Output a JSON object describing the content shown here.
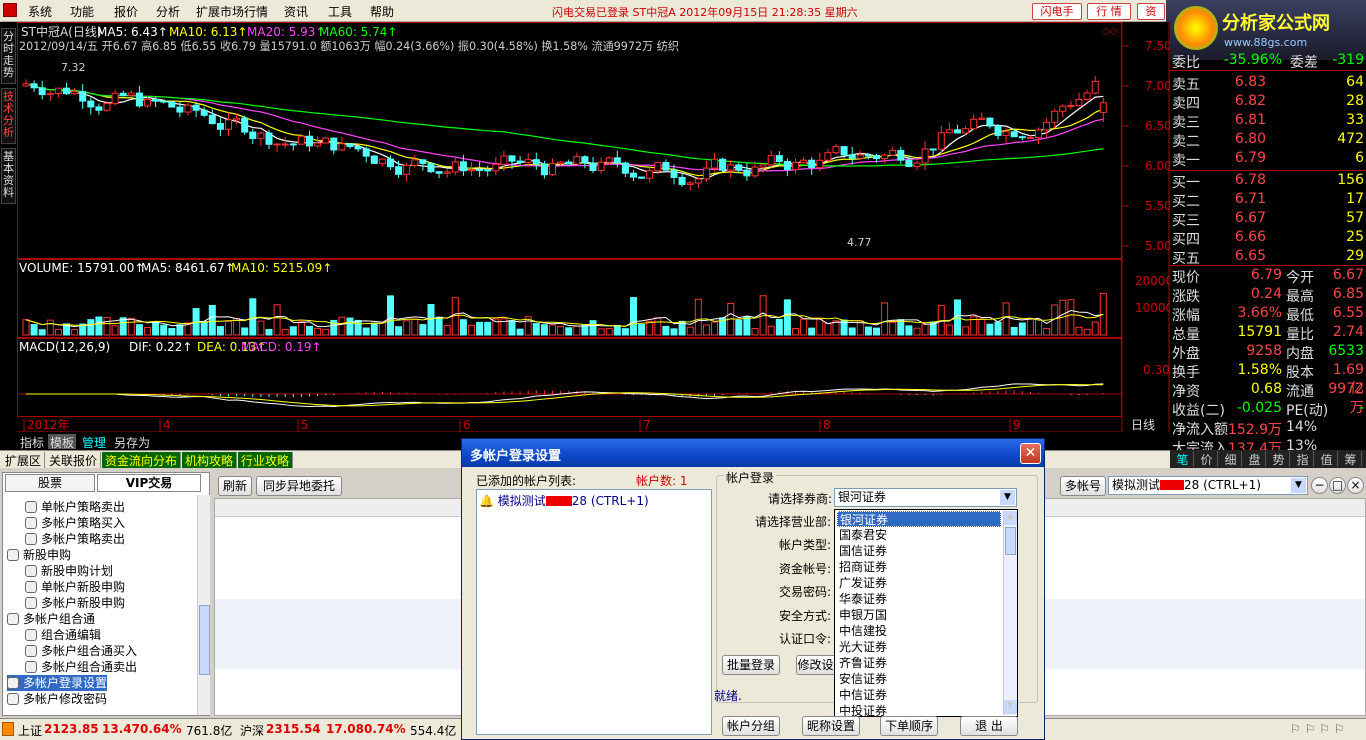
{
  "menu": [
    "系统",
    "功能",
    "报价",
    "分析",
    "扩展市场行情",
    "资讯",
    "工具",
    "帮助"
  ],
  "title_status": "闪电交易已登录   ST中冠A 2012年09月15日 21:28:35 星期六",
  "top_buttons": [
    "闪电手",
    "行 情",
    "资"
  ],
  "logo": {
    "title": "分析家公式网",
    "url": "www.88gs.com"
  },
  "left_tabs": [
    "分时走势",
    "技术分析",
    "基本资料"
  ],
  "chart": {
    "stock_name": "ST中冠A(日线)",
    "ma_info": [
      {
        "label": "MA5: 6.43↑",
        "color": "#ffffff"
      },
      {
        "label": "MA10: 6.13↑",
        "color": "#ffff00"
      },
      {
        "label": "MA20: 5.93↑",
        "color": "#ff44ff"
      },
      {
        "label": "MA60: 5.74↑",
        "color": "#00ff00"
      }
    ],
    "bar_info": "2012/09/14/五 开6.67 高6.85 低6.55 收6.79 量15791.0 额1063万 幅0.24(3.66%) 振0.30(4.58%) 换1.58% 流通9972万 纺织",
    "price_axis": [
      "7.50",
      "7.00",
      "6.50",
      "6.00",
      "5.50",
      "5.00"
    ],
    "hi_label": "7.32",
    "lo_label": "4.77",
    "vol_info": [
      {
        "label": "VOLUME: 15791.00↑",
        "color": "#ffffff"
      },
      {
        "label": "MA5: 8461.67↑",
        "color": "#ffffff"
      },
      {
        "label": "MA10: 5215.09↑",
        "color": "#ffff00"
      }
    ],
    "vol_axis": [
      "20000",
      "10000"
    ],
    "macd_info": [
      {
        "label": "MACD(12,26,9)",
        "color": "#ffffff"
      },
      {
        "label": "DIF: 0.22↑",
        "color": "#ffffff"
      },
      {
        "label": "DEA: 0.13↑",
        "color": "#ffff00"
      },
      {
        "label": "MACD: 0.19↑",
        "color": "#ff44ff"
      }
    ],
    "macd_axis": [
      "0.30"
    ],
    "date_axis": [
      "2012年",
      "4",
      "5",
      "6",
      "7",
      "8",
      "9"
    ],
    "period": "日线"
  },
  "quote": {
    "header": [
      {
        "label": "委比",
        "value": "-35.96%"
      },
      {
        "label": "委差",
        "value": "-319"
      }
    ],
    "sells": [
      {
        "label": "卖五",
        "price": "6.83",
        "vol": "64"
      },
      {
        "label": "卖四",
        "price": "6.82",
        "vol": "28"
      },
      {
        "label": "卖三",
        "price": "6.81",
        "vol": "33"
      },
      {
        "label": "卖二",
        "price": "6.80",
        "vol": "472"
      },
      {
        "label": "卖一",
        "price": "6.79",
        "vol": "6"
      }
    ],
    "buys": [
      {
        "label": "买一",
        "price": "6.78",
        "vol": "156"
      },
      {
        "label": "买二",
        "price": "6.71",
        "vol": "17"
      },
      {
        "label": "买三",
        "price": "6.67",
        "vol": "57"
      },
      {
        "label": "买四",
        "price": "6.66",
        "vol": "25"
      },
      {
        "label": "买五",
        "price": "6.65",
        "vol": "29"
      }
    ],
    "stats": [
      [
        "现价",
        "6.79",
        "今开",
        "6.67"
      ],
      [
        "涨跌",
        "0.24",
        "最高",
        "6.85"
      ],
      [
        "涨幅",
        "3.66%",
        "最低",
        "6.55"
      ],
      [
        "总量",
        "15791",
        "量比",
        "2.74"
      ],
      [
        "外盘",
        "9258",
        "内盘",
        "6533"
      ],
      [
        "换手",
        "1.58%",
        "股本",
        "1.69亿"
      ],
      [
        "净资",
        "0.68",
        "流通",
        "9972万"
      ],
      [
        "收益(二)",
        "-0.025",
        "PE(动)",
        "-"
      ],
      [
        "净流入额",
        "152.9万",
        "14%",
        ""
      ],
      [
        "大宗流入",
        "137.4万",
        "13%",
        ""
      ]
    ]
  },
  "bottom_tabs": [
    "指标",
    "模板",
    "管理",
    "另存为"
  ],
  "quick_tabs": [
    "扩展区",
    "关联报价",
    "资金流向分布",
    "机构攻略",
    "行业攻略"
  ],
  "side_tabs": [
    "笔",
    "价",
    "细",
    "盘",
    "势",
    "指",
    "值",
    "筹"
  ],
  "trade": {
    "tabs": [
      "股票",
      "VIP交易"
    ],
    "tree": [
      {
        "label": "单帐户策略卖出",
        "indent": 1,
        "sel": false
      },
      {
        "label": "多帐户策略买入",
        "indent": 1,
        "sel": false
      },
      {
        "label": "多帐户策略卖出",
        "indent": 1,
        "sel": false
      },
      {
        "label": "新股申购",
        "indent": 0,
        "sel": false
      },
      {
        "label": "新股申购计划",
        "indent": 1,
        "sel": false
      },
      {
        "label": "单帐户新股申购",
        "indent": 1,
        "sel": false
      },
      {
        "label": "多帐户新股申购",
        "indent": 1,
        "sel": false
      },
      {
        "label": "多帐户组合通",
        "indent": 0,
        "sel": false
      },
      {
        "label": "组合通编辑",
        "indent": 1,
        "sel": false
      },
      {
        "label": "多帐户组合通买入",
        "indent": 1,
        "sel": false
      },
      {
        "label": "多帐户组合通卖出",
        "indent": 1,
        "sel": false
      },
      {
        "label": "多帐户登录设置",
        "indent": 0,
        "sel": true
      },
      {
        "label": "多帐户修改密码",
        "indent": 0,
        "sel": false
      }
    ],
    "toolbar": [
      "刷新",
      "同步异地委托"
    ],
    "right_buttons": [
      "多帐号"
    ],
    "account_select": "模拟测试",
    "account_suffix": "28 (CTRL+1)"
  },
  "status": {
    "sh_label": "上证",
    "sh_value": "2123.85",
    "sh_chg": "13.47",
    "sh_pct": "0.64%",
    "sh_amt": "761.8亿",
    "hs_label": "沪深",
    "hs_value": "2315.54",
    "hs_chg": "17.08",
    "hs_pct": "0.74%",
    "hs_amt": "554.4亿"
  },
  "dialog": {
    "title": "多帐户登录设置",
    "list_label": "已添加的帐户列表:",
    "count_label": "帐户数: 1",
    "account_item": "模拟测试",
    "account_suffix": "28 (CTRL+1)",
    "group_label": "帐户登录",
    "fields": [
      "请选择券商:",
      "请选择营业部:",
      "帐户类型:",
      "资金帐号:",
      "交易密码:",
      "安全方式:",
      "认证口令:"
    ],
    "broker_value": "银河证券",
    "brokers": [
      "银河证券",
      "国泰君安",
      "国信证券",
      "招商证券",
      "广发证券",
      "华泰证券",
      "申银万国",
      "中信建投",
      "光大证券",
      "齐鲁证券",
      "安信证券",
      "中信证券",
      "中投证券"
    ],
    "buttons": {
      "batch": "批量登录",
      "modify": "修改设",
      "group": "帐户分组",
      "nickname": "昵称设置",
      "order": "下单顺序",
      "exit": "退 出"
    },
    "ready": "就绪."
  }
}
